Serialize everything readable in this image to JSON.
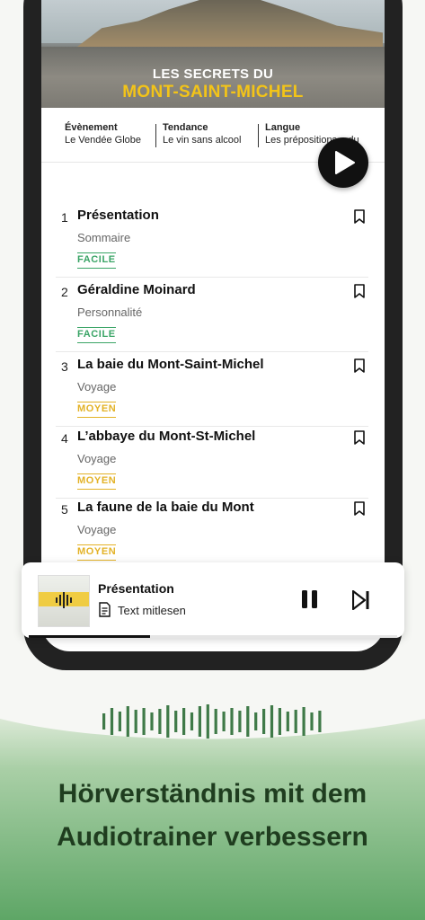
{
  "cover": {
    "line1": "LES SECRETS DU",
    "line2": "MONT-SAINT-MICHEL"
  },
  "categories": [
    {
      "heading": "Évènement",
      "value": "Le Vendée Globe"
    },
    {
      "heading": "Tendance",
      "value": "Le vin sans alcool"
    },
    {
      "heading": "Langue",
      "value": "Les prépositions « du"
    }
  ],
  "episodes": [
    {
      "num": "1",
      "title": "Présentation",
      "subtitle": "Sommaire",
      "level": "FACILE"
    },
    {
      "num": "2",
      "title": "Géraldine Moinard",
      "subtitle": "Personnalité",
      "level": "FACILE"
    },
    {
      "num": "3",
      "title": "La baie du Mont-Saint-Michel",
      "subtitle": "Voyage",
      "level": "MOYEN"
    },
    {
      "num": "4",
      "title": "L’abbaye du Mont-St-Michel",
      "subtitle": "Voyage",
      "level": "MOYEN"
    },
    {
      "num": "5",
      "title": "La faune de la baie du Mont",
      "subtitle": "Voyage",
      "level": "MOYEN"
    }
  ],
  "player": {
    "title": "Présentation",
    "read_along": "Text mitlesen",
    "progress": 0.33
  },
  "headline": {
    "line1": "Hörverständnis mit dem",
    "line2": "Audiotrainer verbessern"
  },
  "colors": {
    "easy": "#3aa466",
    "medium": "#e3b226",
    "green_bg": "#5fa867"
  }
}
